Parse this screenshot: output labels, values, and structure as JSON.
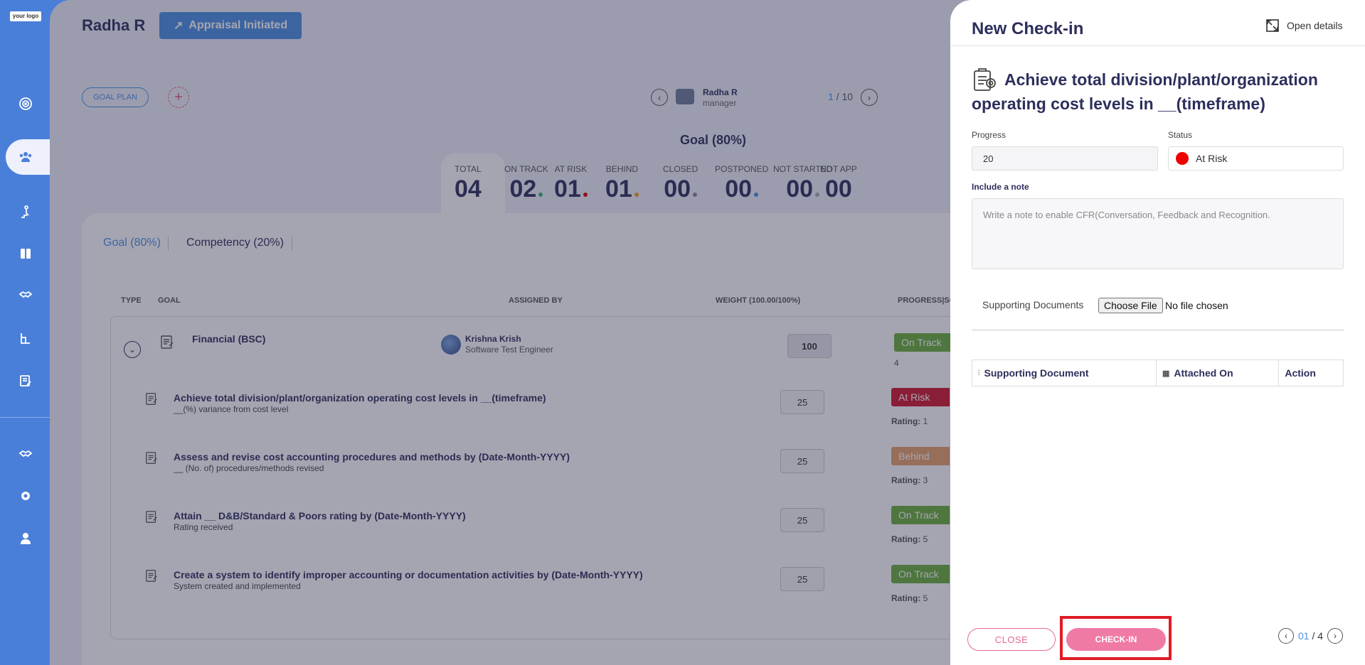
{
  "logo": "your logo",
  "header": {
    "employee_name": "Radha R",
    "appraisal_label": "Appraisal Initiated",
    "goal_plan_label": "GOAL PLAN"
  },
  "pager": {
    "manager_name": "Radha R",
    "manager_role": "manager",
    "current": "1",
    "separator": " / ",
    "total": "10"
  },
  "goal_heading": "Goal (80%)",
  "stats": [
    {
      "label": "TOTAL",
      "value": "04",
      "dot_color": ""
    },
    {
      "label": "ON TRACK",
      "value": "02",
      "dot_color": "#3cb371"
    },
    {
      "label": "AT RISK",
      "value": "01",
      "dot_color": "#e00000"
    },
    {
      "label": "BEHIND",
      "value": "01",
      "dot_color": "#f0a020"
    },
    {
      "label": "CLOSED",
      "value": "00",
      "dot_color": "#888888"
    },
    {
      "label": "POSTPONED",
      "value": "00",
      "dot_color": "#4a90e2"
    },
    {
      "label": "NOT STARTED",
      "value": "00",
      "dot_color": "#aaaaaa"
    },
    {
      "label": "NOT APP",
      "value": "00",
      "dot_color": ""
    }
  ],
  "tabs": {
    "goal": "Goal (80%)",
    "competency": "Competency (20%)"
  },
  "table_headers": {
    "type": "TYPE",
    "goal": "GOAL",
    "assigned_by": "ASSIGNED BY",
    "weight": "WEIGHT (100.00/100%)",
    "progress": "PROGRESS|SC"
  },
  "category": {
    "title": "Financial (BSC)",
    "assignee_name": "Krishna Krish",
    "assignee_role": "Software Test Engineer",
    "weight": "100",
    "status": "On Track",
    "count": "4"
  },
  "goals": [
    {
      "title": "Achieve total division/plant/organization operating cost levels in __(timeframe)",
      "subtitle": "__(%) variance from cost level",
      "weight": "25",
      "status": "At Risk",
      "status_color": "#d0182c",
      "rating_label": "Rating:",
      "rating": "1"
    },
    {
      "title": "Assess and revise cost accounting procedures and methods by (Date-Month-YYYY)",
      "subtitle": "__ (No. of) procedures/methods revised",
      "weight": "25",
      "status": "Behind",
      "status_color": "#e6a06a",
      "rating_label": "Rating:",
      "rating": "3"
    },
    {
      "title": "Attain __ D&B/Standard & Poors rating by (Date-Month-YYYY)",
      "subtitle": "Rating received",
      "weight": "25",
      "status": "On Track",
      "status_color": "#6aae3a",
      "rating_label": "Rating:",
      "rating": "5"
    },
    {
      "title": "Create a system to identify improper accounting or documentation activities by (Date-Month-YYYY)",
      "subtitle": "System created and implemented",
      "weight": "25",
      "status": "On Track",
      "status_color": "#6aae3a",
      "rating_label": "Rating:",
      "rating": "5"
    }
  ],
  "panel": {
    "title": "New Check-in",
    "open_details": "Open details",
    "goal_title": "Achieve total division/plant/organization operating cost levels in __(timeframe)",
    "progress_label": "Progress",
    "progress_value": "20",
    "status_label": "Status",
    "status_value": "At Risk",
    "note_label": "Include a note",
    "note_placeholder": "Write a note to enable CFR(Conversation, Feedback and Recognition.",
    "supporting_label": "Supporting Documents",
    "choose_file": "Choose File",
    "no_file": "No file chosen",
    "doc_headers": [
      "Supporting Document",
      "Attached On",
      "Action"
    ],
    "close_label": "CLOSE",
    "checkin_label": "CHECK-IN",
    "page_current": "01",
    "page_sep": " / ",
    "page_total": "4"
  }
}
